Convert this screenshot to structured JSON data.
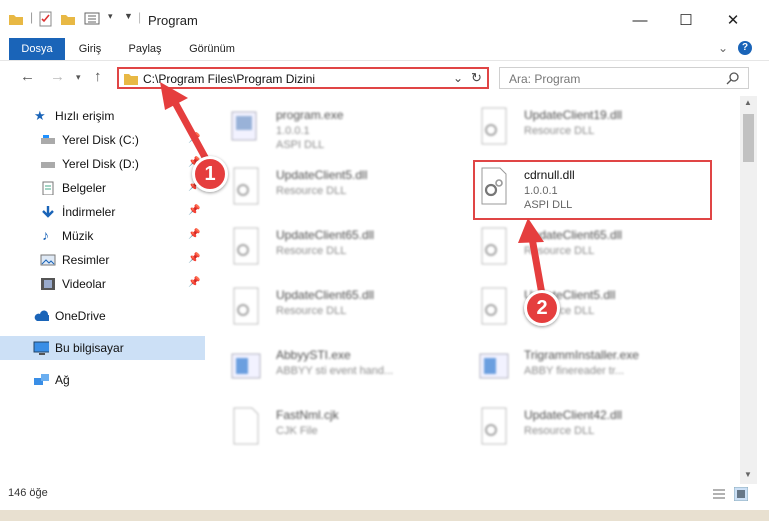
{
  "window": {
    "title": "Program"
  },
  "ribbon": {
    "tabs": [
      "Dosya",
      "Giriş",
      "Paylaş",
      "Görünüm"
    ]
  },
  "address": {
    "path": "C:\\Program Files\\Program Dizini"
  },
  "search": {
    "placeholder": "Ara: Program"
  },
  "sidebar": {
    "items": [
      {
        "label": "Hızlı erişim",
        "icon": "star-icon"
      },
      {
        "label": "Yerel Disk (C:)",
        "icon": "drive-icon"
      },
      {
        "label": "Yerel Disk (D:)",
        "icon": "drive-icon"
      },
      {
        "label": "Belgeler",
        "icon": "documents-icon"
      },
      {
        "label": "İndirmeler",
        "icon": "download-icon"
      },
      {
        "label": "Müzik",
        "icon": "music-icon"
      },
      {
        "label": "Resimler",
        "icon": "pictures-icon"
      },
      {
        "label": "Videolar",
        "icon": "videos-icon"
      },
      {
        "label": "OneDrive",
        "icon": "cloud-icon"
      },
      {
        "label": "Bu bilgisayar",
        "icon": "computer-icon"
      },
      {
        "label": "Ağ",
        "icon": "network-icon"
      }
    ]
  },
  "files": [
    {
      "name": "program.exe",
      "line1": "1.0.0.1",
      "line2": "ASPI DLL"
    },
    {
      "name": "UpdateClient19.dll",
      "line1": "Resource DLL",
      "line2": ""
    },
    {
      "name": "UpdateClient5.dll",
      "line1": "Resource DLL",
      "line2": ""
    },
    {
      "name": "cdrnull.dll",
      "line1": "1.0.0.1",
      "line2": "ASPI DLL"
    },
    {
      "name": "UpdateClient65.dll",
      "line1": "Resource DLL",
      "line2": ""
    },
    {
      "name": "UpdateClient65.dll",
      "line1": "Resource DLL",
      "line2": ""
    },
    {
      "name": "UpdateClient65.dll",
      "line1": "Resource DLL",
      "line2": ""
    },
    {
      "name": "UpdateClient5.dll",
      "line1": "Resource DLL",
      "line2": ""
    },
    {
      "name": "AbbyySTI.exe",
      "line1": "ABBYY sti event hand...",
      "line2": ""
    },
    {
      "name": "TrigrammInstaller.exe",
      "line1": "ABBY finereader tr...",
      "line2": ""
    },
    {
      "name": "FastNml.cjk",
      "line1": "CJK File",
      "line2": ""
    },
    {
      "name": "UpdateClient42.dll",
      "line1": "Resource DLL",
      "line2": ""
    }
  ],
  "status": {
    "count": "146 öğe"
  },
  "callouts": [
    "1",
    "2"
  ],
  "colors": {
    "accent": "#1a64b8",
    "highlight": "#e04545",
    "callout": "#e53e3e"
  }
}
